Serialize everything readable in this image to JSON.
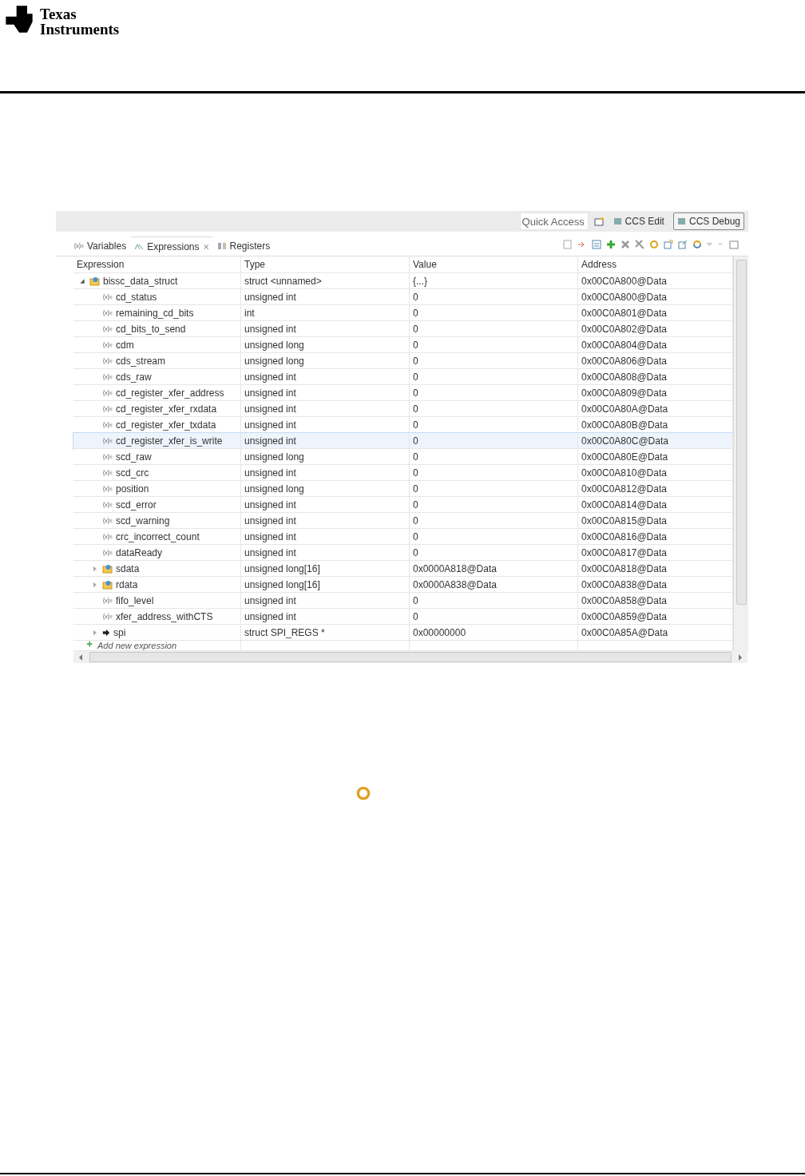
{
  "header": {
    "logo": {
      "line_1": "Texas",
      "line_2": "Instruments"
    }
  },
  "ide": {
    "quick_access": {
      "placeholder": "Quick Access"
    },
    "perspectives": [
      {
        "label": "CCS Edit",
        "selected": false
      },
      {
        "label": "CCS Debug",
        "selected": true
      }
    ],
    "views": [
      {
        "label": "Variables",
        "selected": false
      },
      {
        "label": "Expressions",
        "selected": true,
        "close": "⨯"
      },
      {
        "label": "Registers",
        "selected": false
      }
    ],
    "table": {
      "columns": [
        "Expression",
        "Type",
        "Value",
        "Address"
      ],
      "rows": [
        {
          "kind": "struct",
          "name": "bissc_data_struct",
          "type": "struct <unnamed>",
          "value": "{...}",
          "address": "0x00C0A800@Data",
          "expanded": true,
          "selected": false,
          "children": [
            {
              "kind": "var",
              "name": "cd_status",
              "type": "unsigned int",
              "value": "0",
              "address": "0x00C0A800@Data",
              "selected": false
            },
            {
              "kind": "var",
              "name": "remaining_cd_bits",
              "type": "int",
              "value": "0",
              "address": "0x00C0A801@Data",
              "selected": false
            },
            {
              "kind": "var",
              "name": "cd_bits_to_send",
              "type": "unsigned int",
              "value": "0",
              "address": "0x00C0A802@Data",
              "selected": false
            },
            {
              "kind": "var",
              "name": "cdm",
              "type": "unsigned long",
              "value": "0",
              "address": "0x00C0A804@Data",
              "selected": false
            },
            {
              "kind": "var",
              "name": "cds_stream",
              "type": "unsigned long",
              "value": "0",
              "address": "0x00C0A806@Data",
              "selected": false
            },
            {
              "kind": "var",
              "name": "cds_raw",
              "type": "unsigned int",
              "value": "0",
              "address": "0x00C0A808@Data",
              "selected": false
            },
            {
              "kind": "var",
              "name": "cd_register_xfer_address",
              "type": "unsigned int",
              "value": "0",
              "address": "0x00C0A809@Data",
              "selected": false
            },
            {
              "kind": "var",
              "name": "cd_register_xfer_rxdata",
              "type": "unsigned int",
              "value": "0",
              "address": "0x00C0A80A@Data",
              "selected": false
            },
            {
              "kind": "var",
              "name": "cd_register_xfer_txdata",
              "type": "unsigned int",
              "value": "0",
              "address": "0x00C0A80B@Data",
              "selected": false
            },
            {
              "kind": "var",
              "name": "cd_register_xfer_is_write",
              "type": "unsigned int",
              "value": "0",
              "address": "0x00C0A80C@Data",
              "selected": true
            },
            {
              "kind": "var",
              "name": "scd_raw",
              "type": "unsigned long",
              "value": "0",
              "address": "0x00C0A80E@Data",
              "selected": false
            },
            {
              "kind": "var",
              "name": "scd_crc",
              "type": "unsigned int",
              "value": "0",
              "address": "0x00C0A810@Data",
              "selected": false
            },
            {
              "kind": "var",
              "name": "position",
              "type": "unsigned long",
              "value": "0",
              "address": "0x00C0A812@Data",
              "selected": false
            },
            {
              "kind": "var",
              "name": "scd_error",
              "type": "unsigned int",
              "value": "0",
              "address": "0x00C0A814@Data",
              "selected": false
            },
            {
              "kind": "var",
              "name": "scd_warning",
              "type": "unsigned int",
              "value": "0",
              "address": "0x00C0A815@Data",
              "selected": false
            },
            {
              "kind": "var",
              "name": "crc_incorrect_count",
              "type": "unsigned int",
              "value": "0",
              "address": "0x00C0A816@Data",
              "selected": false
            },
            {
              "kind": "var",
              "name": "dataReady",
              "type": "unsigned int",
              "value": "0",
              "address": "0x00C0A817@Data",
              "selected": false
            },
            {
              "kind": "struct",
              "name": "sdata",
              "type": "unsigned long[16]",
              "value": "0x0000A818@Data",
              "address": "0x00C0A818@Data",
              "expanded": false,
              "selected": false
            },
            {
              "kind": "struct",
              "name": "rdata",
              "type": "unsigned long[16]",
              "value": "0x0000A838@Data",
              "address": "0x00C0A838@Data",
              "expanded": false,
              "selected": false
            },
            {
              "kind": "var",
              "name": "fifo_level",
              "type": "unsigned int",
              "value": "0",
              "address": "0x00C0A858@Data",
              "selected": false
            },
            {
              "kind": "var",
              "name": "xfer_address_withCTS",
              "type": "unsigned int",
              "value": "0",
              "address": "0x00C0A859@Data",
              "selected": false
            },
            {
              "kind": "pointer",
              "name": "spi",
              "type": "struct SPI_REGS *",
              "value": "0x00000000",
              "address": "0x00C0A85A@Data",
              "expanded": false,
              "selected": false
            }
          ]
        }
      ],
      "add_row": "Add new expression"
    }
  }
}
